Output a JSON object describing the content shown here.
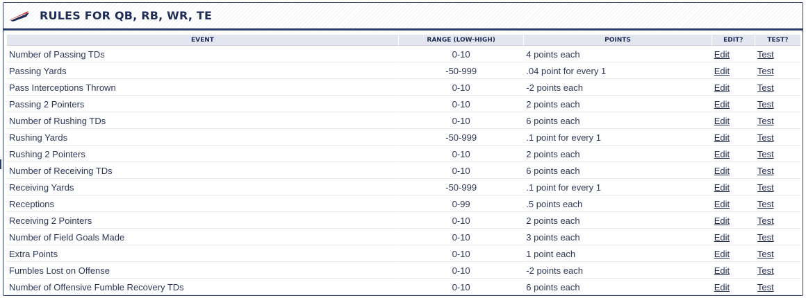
{
  "panel": {
    "title": "RULES FOR QB, RB, WR, TE",
    "logo_icon": "flag-logo-icon"
  },
  "table": {
    "headers": {
      "event": "EVENT",
      "range": "RANGE (LOW-HIGH)",
      "points": "POINTS",
      "edit": "EDIT?",
      "test": "TEST?"
    },
    "rows": [
      {
        "event": "Number of Passing TDs",
        "range": "0-10",
        "points": "4 points each",
        "edit": "Edit",
        "test": "Test"
      },
      {
        "event": "Passing Yards",
        "range": "-50-999",
        "points": ".04 point for every 1",
        "edit": "Edit",
        "test": "Test"
      },
      {
        "event": "Pass Interceptions Thrown",
        "range": "0-10",
        "points": "-2 points each",
        "edit": "Edit",
        "test": "Test"
      },
      {
        "event": "Passing 2 Pointers",
        "range": "0-10",
        "points": "2 points each",
        "edit": "Edit",
        "test": "Test"
      },
      {
        "event": "Number of Rushing TDs",
        "range": "0-10",
        "points": "6 points each",
        "edit": "Edit",
        "test": "Test"
      },
      {
        "event": "Rushing Yards",
        "range": "-50-999",
        "points": ".1 point for every 1",
        "edit": "Edit",
        "test": "Test"
      },
      {
        "event": "Rushing 2 Pointers",
        "range": "0-10",
        "points": "2 points each",
        "edit": "Edit",
        "test": "Test"
      },
      {
        "event": "Number of Receiving TDs",
        "range": "0-10",
        "points": "6 points each",
        "edit": "Edit",
        "test": "Test"
      },
      {
        "event": "Receiving Yards",
        "range": "-50-999",
        "points": ".1 point for every 1",
        "edit": "Edit",
        "test": "Test"
      },
      {
        "event": "Receptions",
        "range": "0-99",
        "points": ".5 points each",
        "edit": "Edit",
        "test": "Test"
      },
      {
        "event": "Receiving 2 Pointers",
        "range": "0-10",
        "points": "2 points each",
        "edit": "Edit",
        "test": "Test"
      },
      {
        "event": "Number of Field Goals Made",
        "range": "0-10",
        "points": "3 points each",
        "edit": "Edit",
        "test": "Test"
      },
      {
        "event": "Extra Points",
        "range": "0-10",
        "points": "1 point each",
        "edit": "Edit",
        "test": "Test"
      },
      {
        "event": "Fumbles Lost on Offense",
        "range": "0-10",
        "points": "-2 points each",
        "edit": "Edit",
        "test": "Test"
      },
      {
        "event": "Number of Offensive Fumble Recovery TDs",
        "range": "0-10",
        "points": "6 points each",
        "edit": "Edit",
        "test": "Test"
      }
    ]
  },
  "colors": {
    "accent": "#1f2d55",
    "logo_red": "#d1232a",
    "header_bg": "#e3e6ee"
  }
}
